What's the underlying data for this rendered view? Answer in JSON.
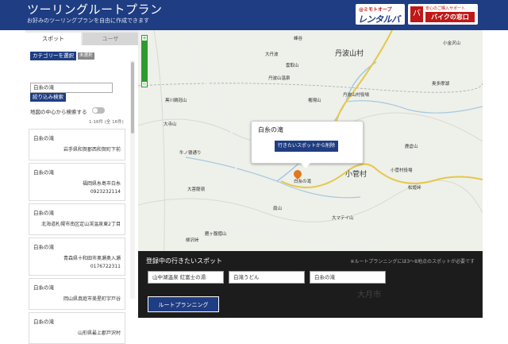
{
  "header": {
    "title": "ツーリングルートプラン",
    "subtitle": "お好みのツーリングプランを自由に作成できます",
    "logo_rental": {
      "top": "@ミモトオープ",
      "main": "レンタルバイク"
    },
    "logo_shop": {
      "icon": "バ",
      "top": "安心のご購入サポート",
      "main": "バイクの窓口"
    }
  },
  "sidebar": {
    "tabs": [
      {
        "label": "スポット"
      },
      {
        "label": "ユーザ"
      }
    ],
    "category_button": "カテゴリーを選択",
    "category_badge": "未選択",
    "search_value": "白糸の滝",
    "filter_button": "絞り込み検索",
    "map_center_label": "地図の中心から検索する",
    "result_count": "1-16件 (全 16件)",
    "results": [
      {
        "name": "白糸の滝",
        "address": "岩手県和賀郡西和賀町下前",
        "phone": ""
      },
      {
        "name": "白糸の滝",
        "address": "福岡県糸島市白糸",
        "phone": "0923232114"
      },
      {
        "name": "白糸の滝",
        "address": "北海道札幌市南区定山渓温泉東2丁目",
        "phone": ""
      },
      {
        "name": "白糸の滝",
        "address": "青森県十和田市奥瀬奥入瀬",
        "phone": "0176722311"
      },
      {
        "name": "白糸の滝",
        "address": "岡山県真庭市美星町宇戸谷",
        "phone": ""
      },
      {
        "name": "白糸の滝",
        "address": "山形県最上郡戸沢村",
        "phone": ""
      }
    ]
  },
  "map": {
    "popup_title": "白糸の滝",
    "popup_button": "行きたいスポットから削除",
    "pin_label": "白糸の滝",
    "place_labels": [
      "丹波山村",
      "小菅村",
      "大月市",
      "丹波山村役場",
      "小菅村役場",
      "小金沢山",
      "大菩薩嶺",
      "雁ヶ腹摺山",
      "奥多摩湖",
      "鹿倉山",
      "大マテイ山",
      "牛ノ寝通り",
      "大寺山",
      "権現山",
      "扇山",
      "丹波山温泉",
      "峰谷",
      "大丹波",
      "雲取山",
      "黒川鶏冠山",
      "松姫峠",
      "柳沢峠"
    ]
  },
  "bottom": {
    "title": "登録中の行きたいスポット",
    "note": "※ルートプランニングには3〜8地点のスポットが必要です",
    "slots": [
      "山中湖温泉 紅富士の湯",
      "白滝うどん",
      "白糸の滝"
    ],
    "route_button": "ルートプランニング",
    "map_city": "大月市"
  },
  "colors": {
    "header_bg": "#1f3d82",
    "accent_red": "#c01818",
    "pin": "#e07820"
  }
}
